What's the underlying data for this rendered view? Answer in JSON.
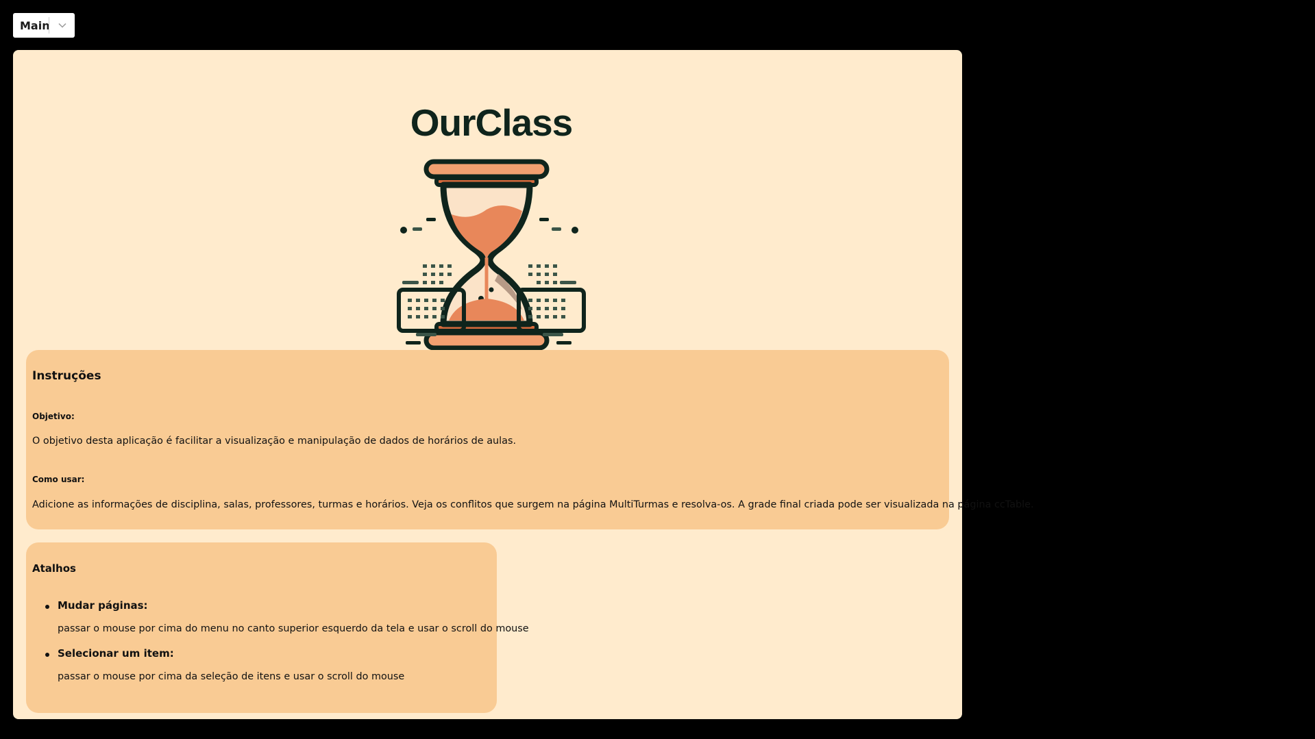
{
  "page_selector": {
    "selected": "Main",
    "chevron_icon": "chevron-down-icon"
  },
  "logo": {
    "title": "OurClass",
    "icon": "hourglass-icon"
  },
  "instructions": {
    "title": "Instruções",
    "objective_heading": "Objetivo:",
    "objective_text": "O objetivo desta aplicação é facilitar a visualização e manipulação de dados de horários de aulas.",
    "howto_heading": "Como usar:",
    "howto_text": "Adicione as informações de disciplina, salas, professores, turmas e horários. Veja os conflitos que surgem na página MultiTurmas e resolva-os. A grade final criada pode ser visualizada na página ccTable."
  },
  "shortcuts": {
    "title": "Atalhos",
    "items": [
      {
        "heading": "Mudar páginas:",
        "text": "passar o mouse por cima do menu no canto superior esquerdo da tela e usar o scroll do mouse"
      },
      {
        "heading": "Selecionar um item:",
        "text": "passar o mouse por cima da seleção de itens e usar o scroll do mouse"
      }
    ]
  },
  "colors": {
    "background": "#000000",
    "panel": "#ffebcd",
    "card": "#f9cb94",
    "sand": "#e8875a",
    "outline": "#0f241c"
  }
}
